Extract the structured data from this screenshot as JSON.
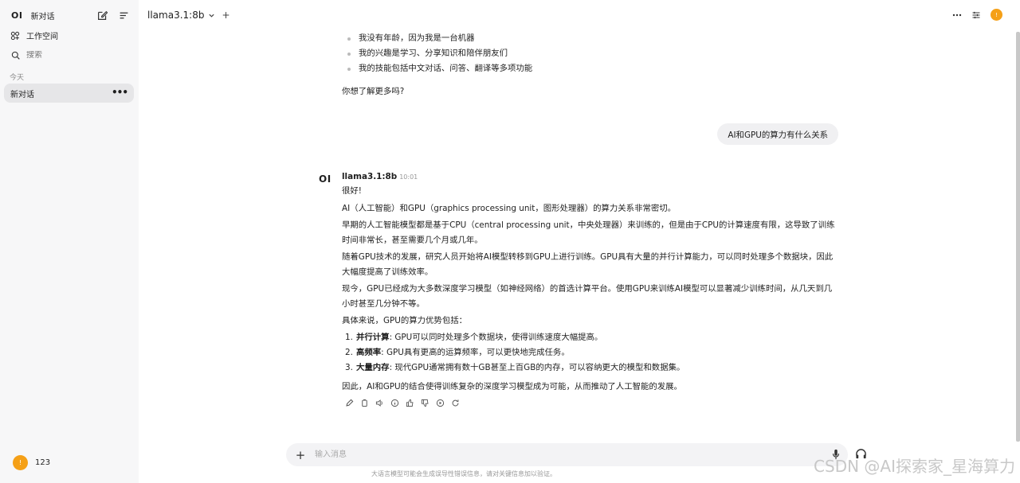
{
  "sidebar": {
    "logo": "OI",
    "new_chat": "新对话",
    "workspace": "工作空间",
    "search_placeholder": "搜索",
    "section_today": "今天",
    "chat_item": "新对话",
    "user_initial": "!",
    "user_name": "123"
  },
  "header": {
    "model_name": "llama3.1:8b",
    "avatar_initial": "!"
  },
  "messages": {
    "prev_bullets": [
      "我没有年龄，因为我是一台机器",
      "我的兴趣是学习、分享知识和陪伴朋友们",
      "我的技能包括中文对话、问答、翻译等多项功能"
    ],
    "prev_closing": "你想了解更多吗?",
    "user_question": "AI和GPU的算力有什么关系",
    "bot_logo": "OI",
    "bot_name": "llama3.1:8b",
    "bot_time": "10:01",
    "paragraphs": [
      "很好!",
      "AI（人工智能）和GPU（graphics processing unit，图形处理器）的算力关系非常密切。",
      "早期的人工智能模型都是基于CPU（central processing unit，中央处理器）来训练的，但是由于CPU的计算速度有限，这导致了训练时间非常长，甚至需要几个月或几年。",
      "随着GPU技术的发展，研究人员开始将AI模型转移到GPU上进行训练。GPU具有大量的并行计算能力，可以同时处理多个数据块，因此大幅度提高了训练效率。",
      "现今，GPU已经成为大多数深度学习模型（如神经网络）的首选计算平台。使用GPU来训练AI模型可以显著减少训练时间，从几天到几小时甚至几分钟不等。",
      "具体来说，GPU的算力优势包括："
    ],
    "list": [
      {
        "num": "1.",
        "term": "并行计算",
        "desc": ": GPU可以同时处理多个数据块，使得训练速度大幅提高。"
      },
      {
        "num": "2.",
        "term": "高频率",
        "desc": ": GPU具有更高的运算频率，可以更快地完成任务。"
      },
      {
        "num": "3.",
        "term": "大量内存",
        "desc": ": 现代GPU通常拥有数十GB甚至上百GB的内存，可以容纳更大的模型和数据集。"
      }
    ],
    "conclusion": "因此，AI和GPU的结合使得训练复杂的深度学习模型成为可能，从而推动了人工智能的发展。"
  },
  "input": {
    "placeholder": "输入消息"
  },
  "footer": {
    "disclaimer": "大语言模型可能会生成误导性错误信息，请对关键信息加以验证。",
    "watermark": "CSDN @AI探索家_星海算力"
  }
}
